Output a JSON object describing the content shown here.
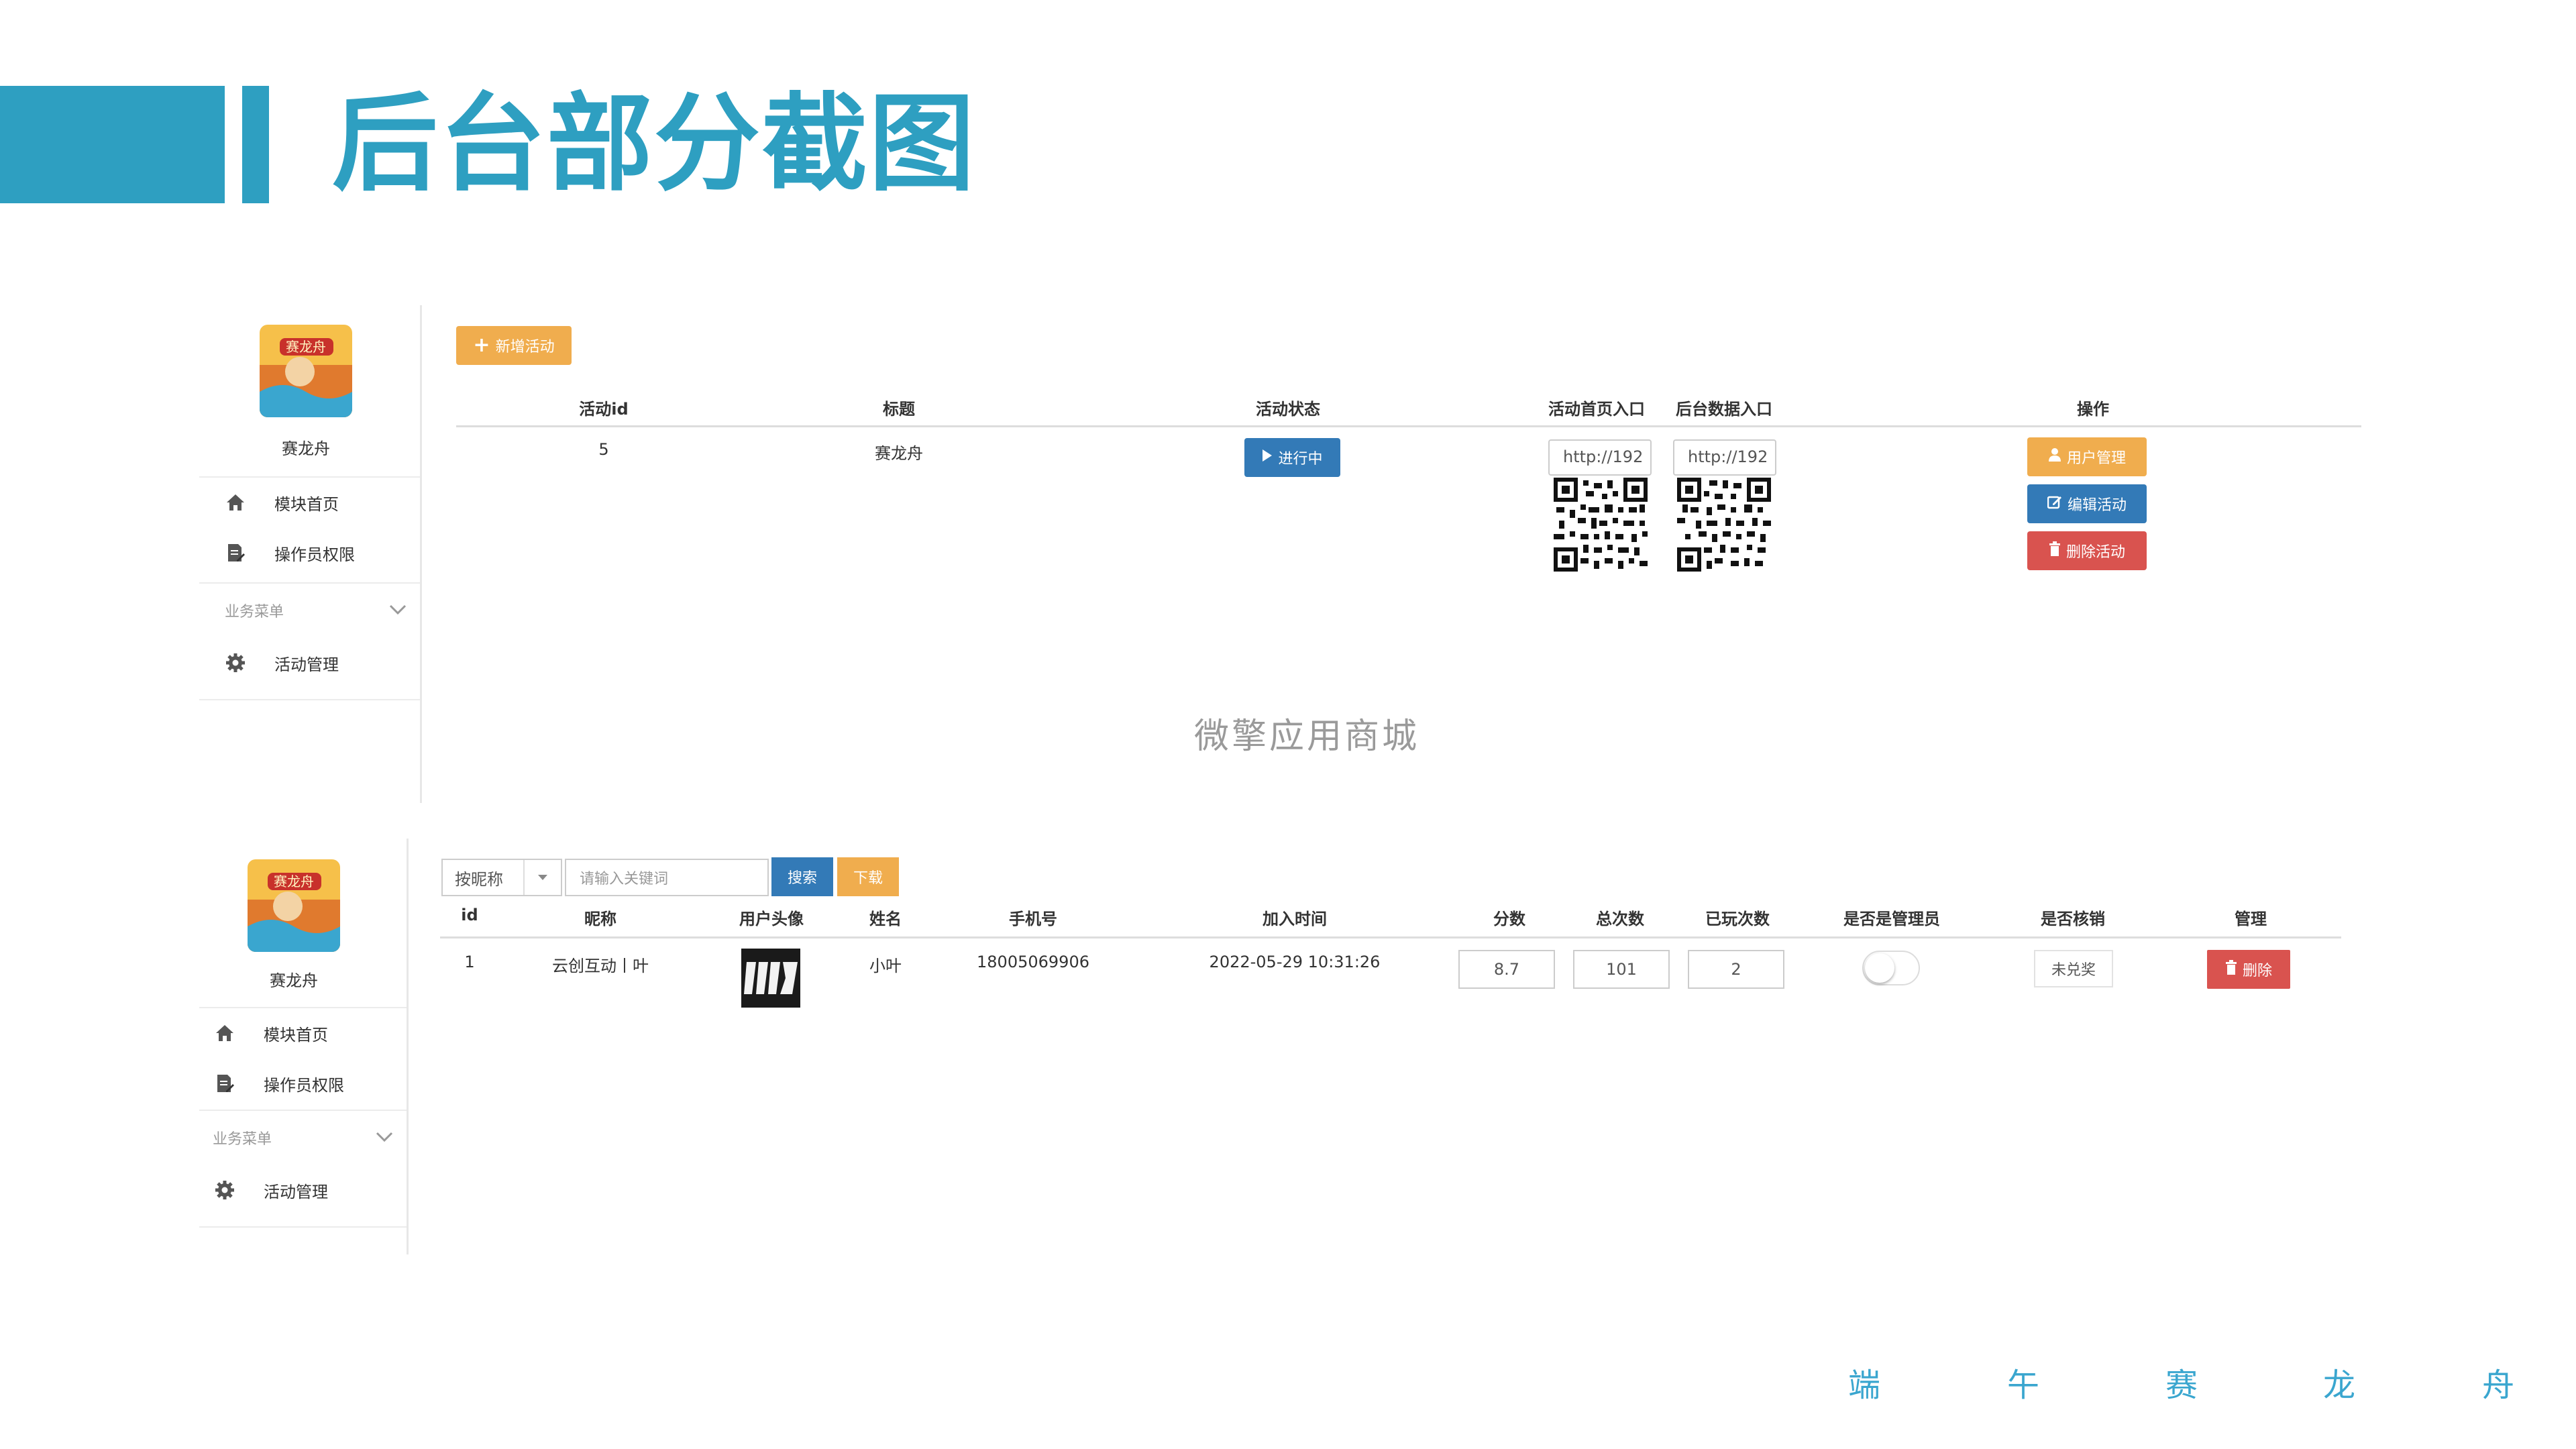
{
  "slide": {
    "title": "后台部分截图",
    "footer": [
      "端",
      "午",
      "赛",
      "龙",
      "舟"
    ],
    "watermark": "微擎应用商城"
  },
  "colors": {
    "accent": "#2e9fc1",
    "orange": "#f0ad4e",
    "blue": "#337ab7",
    "red": "#d9534f"
  },
  "sidebar": {
    "app_name": "赛龙舟",
    "items": [
      {
        "label": "模块首页",
        "icon": "home-icon"
      },
      {
        "label": "操作员权限",
        "icon": "document-edit-icon"
      }
    ],
    "section_label": "业务菜单",
    "section_items": [
      {
        "label": "活动管理",
        "icon": "gear-icon"
      }
    ]
  },
  "activity_panel": {
    "add_button": "新增活动",
    "headers": [
      "活动id",
      "标题",
      "活动状态",
      "活动首页入口",
      "后台数据入口",
      "操作"
    ],
    "row": {
      "id": "5",
      "title": "赛龙舟",
      "status": "进行中",
      "home_url": "http://192",
      "admin_url": "http://192",
      "actions": [
        "用户管理",
        "编辑活动",
        "删除活动"
      ]
    }
  },
  "user_panel": {
    "filter_select": "按昵称",
    "search_placeholder": "请输入关键词",
    "search_button": "搜索",
    "download_button": "下载",
    "headers": [
      "id",
      "昵称",
      "用户头像",
      "姓名",
      "手机号",
      "加入时间",
      "分数",
      "总次数",
      "已玩次数",
      "是否是管理员",
      "是否核销",
      "管理"
    ],
    "row": {
      "id": "1",
      "nickname": "云创互动丨叶",
      "name": "小叶",
      "phone": "18005069906",
      "join_time": "2022-05-29 10:31:26",
      "score": "8.7",
      "total": "101",
      "played": "2",
      "is_admin": false,
      "redeem_status": "未兑奖",
      "delete_button": "删除"
    }
  }
}
